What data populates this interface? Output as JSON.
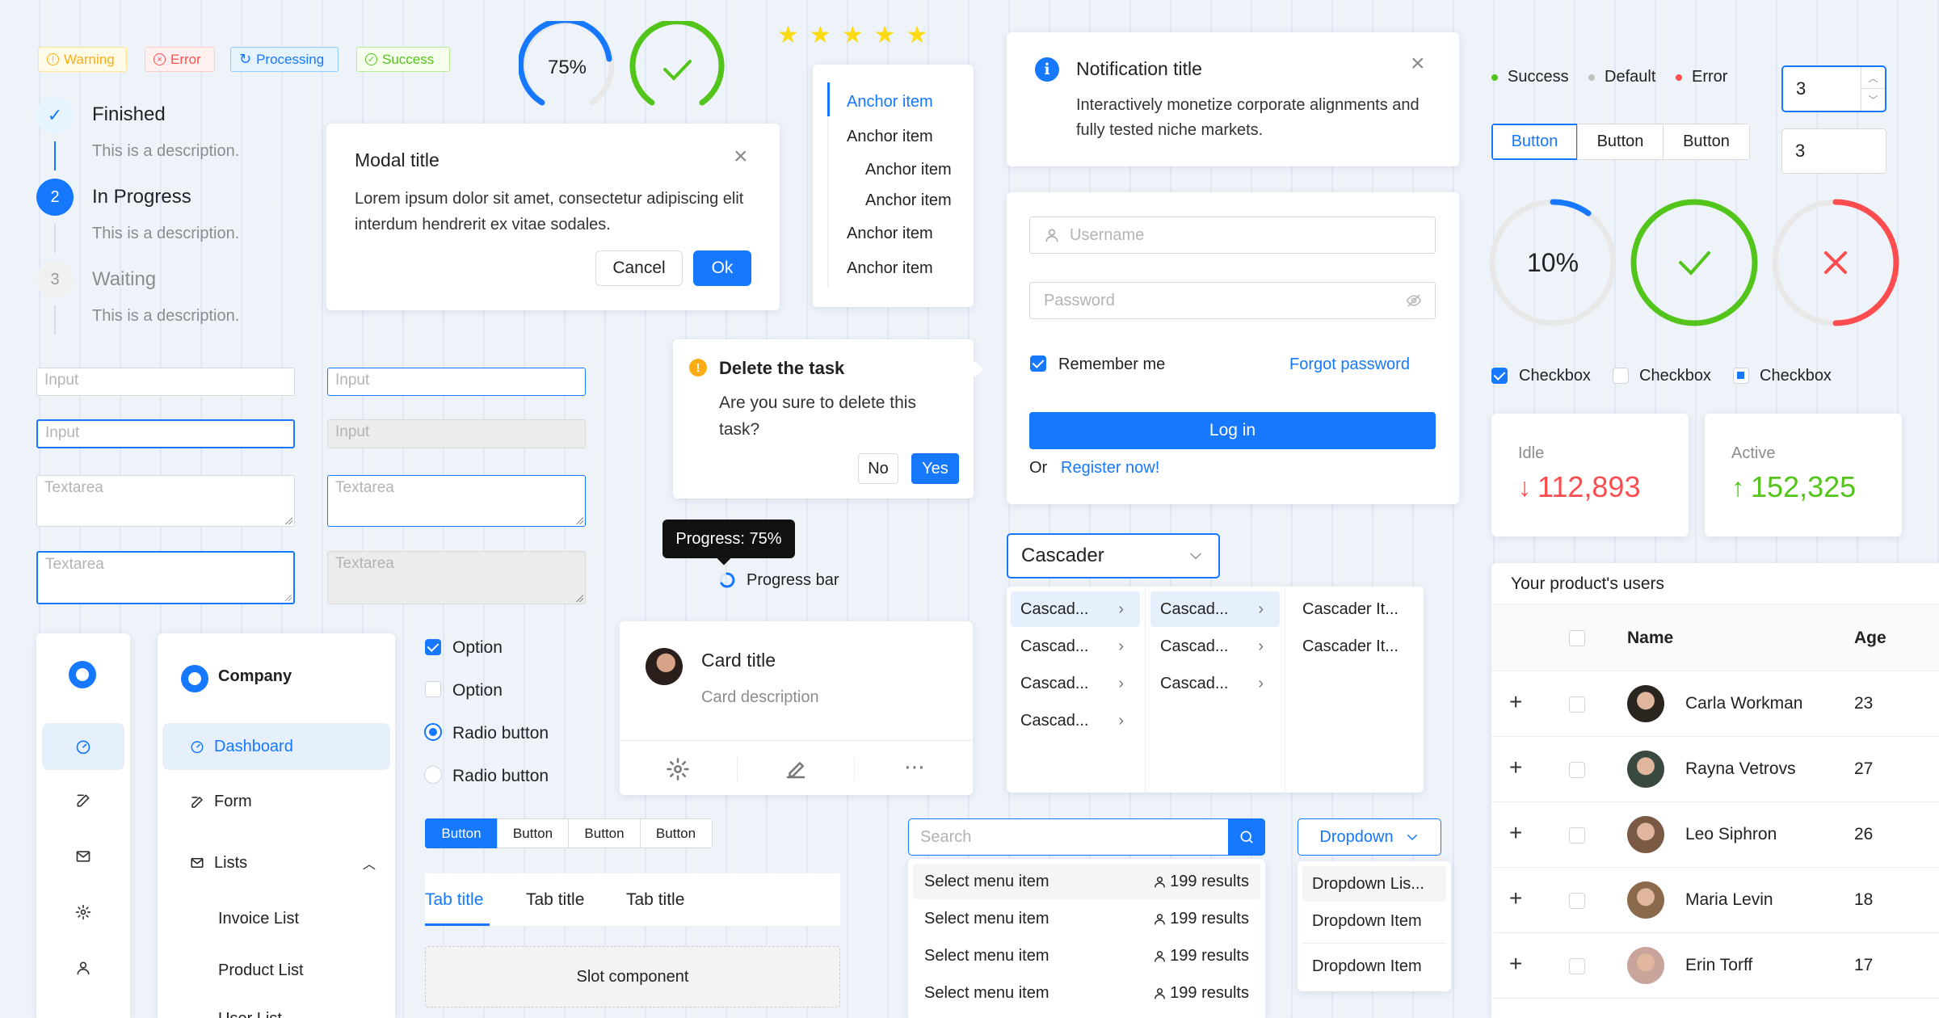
{
  "tags": [
    {
      "label": "Warning",
      "color": "#faad14",
      "bg": "#fffbe6",
      "icon": "!"
    },
    {
      "label": "Error",
      "color": "#ff4d4f",
      "bg": "#fff1f0",
      "icon": "×"
    },
    {
      "label": "Processing",
      "color": "#1677ff",
      "bg": "#e6f4ff",
      "icon": "↻"
    },
    {
      "label": "Success",
      "color": "#52c41a",
      "bg": "#f6ffed",
      "icon": "✓"
    }
  ],
  "progress_circles": {
    "small_percent_label": "75%",
    "small_percent_value": 0.75,
    "large_percent_label": "10%",
    "large_percent_value": 0.1
  },
  "rating": {
    "value": 5,
    "max": 5
  },
  "steps": [
    {
      "number": "",
      "title": "Finished",
      "desc": "This is a description."
    },
    {
      "number": "2",
      "title": "In Progress",
      "desc": "This is a description."
    },
    {
      "number": "3",
      "title": "Waiting",
      "desc": "This is a description."
    }
  ],
  "modal": {
    "title": "Modal title",
    "body": "Lorem ipsum dolor sit amet, consectetur adipiscing elit interdum hendrerit ex vitae sodales.",
    "cancel": "Cancel",
    "ok": "Ok"
  },
  "anchor": {
    "items": [
      "Anchor item",
      "Anchor item",
      "Anchor item",
      "Anchor item",
      "Anchor item",
      "Anchor item"
    ]
  },
  "notification": {
    "title": "Notification title",
    "body": "Interactively monetize corporate alignments and fully tested niche markets."
  },
  "login": {
    "username_placeholder": "Username",
    "password_placeholder": "Password",
    "remember": "Remember me",
    "forgot": "Forgot password",
    "login": "Log in",
    "or": "Or",
    "register": "Register now!"
  },
  "popconfirm": {
    "title": "Delete the task",
    "body": "Are you sure to delete this task?",
    "no": "No",
    "yes": "Yes"
  },
  "tooltip": {
    "text": "Progress: 75%",
    "label": "Progress bar"
  },
  "inputs": {
    "input": "Input",
    "textarea": "Textarea"
  },
  "sidebar": {
    "company": "Company",
    "items": [
      {
        "label": "Dashboard"
      },
      {
        "label": "Form"
      },
      {
        "label": "Lists"
      }
    ],
    "sub_items": [
      "Invoice List",
      "Product List",
      "User List"
    ]
  },
  "options": {
    "checkbox1": "Option",
    "checkbox2": "Option",
    "radio1": "Radio button",
    "radio2": "Radio button"
  },
  "small_buttons": [
    "Button",
    "Button",
    "Button",
    "Button"
  ],
  "tabs": [
    "Tab title",
    "Tab title",
    "Tab title"
  ],
  "slot": "Slot component",
  "card": {
    "title": "Card title",
    "desc": "Card description"
  },
  "cascader": {
    "value": "Cascader",
    "col1": [
      "Cascad...",
      "Cascad...",
      "Cascad...",
      "Cascad..."
    ],
    "col2": [
      "Cascad...",
      "Cascad...",
      "Cascad..."
    ],
    "col3": [
      "Cascader It...",
      "Cascader It..."
    ]
  },
  "search": {
    "placeholder": "Search",
    "items": [
      {
        "label": "Select menu item",
        "count": "199 results"
      },
      {
        "label": "Select menu item",
        "count": "199 results"
      },
      {
        "label": "Select menu item",
        "count": "199 results"
      },
      {
        "label": "Select menu item",
        "count": "199 results"
      }
    ]
  },
  "dropdown": {
    "label": "Dropdown",
    "items": [
      "Dropdown Lis...",
      "Dropdown Item",
      "Dropdown Item"
    ]
  },
  "badges": [
    {
      "label": "Success",
      "color": "#52c41a"
    },
    {
      "label": "Default",
      "color": "#bfbfbf"
    },
    {
      "label": "Error",
      "color": "#ff4d4f"
    }
  ],
  "number_inputs": [
    "3",
    "3"
  ],
  "seg_buttons": [
    "Button",
    "Button",
    "Button"
  ],
  "checkboxes": [
    "Checkbox",
    "Checkbox",
    "Checkbox"
  ],
  "stats": [
    {
      "label": "Idle",
      "value": "112,893",
      "color": "#ff4d4f",
      "dir": "down"
    },
    {
      "label": "Active",
      "value": "152,325",
      "color": "#52c41a",
      "dir": "up"
    }
  ],
  "table": {
    "title": "Your product's users",
    "col_name": "Name",
    "col_age": "Age",
    "rows": [
      {
        "name": "Carla Workman",
        "age": "23",
        "avatar": "#2b2520"
      },
      {
        "name": "Rayna Vetrovs",
        "age": "27",
        "avatar": "#3a4a40"
      },
      {
        "name": "Leo Siphron",
        "age": "26",
        "avatar": "#7a5a45"
      },
      {
        "name": "Maria Levin",
        "age": "18",
        "avatar": "#8a6a4a"
      },
      {
        "name": "Erin Torff",
        "age": "17",
        "avatar": "#c9a49a"
      }
    ]
  }
}
